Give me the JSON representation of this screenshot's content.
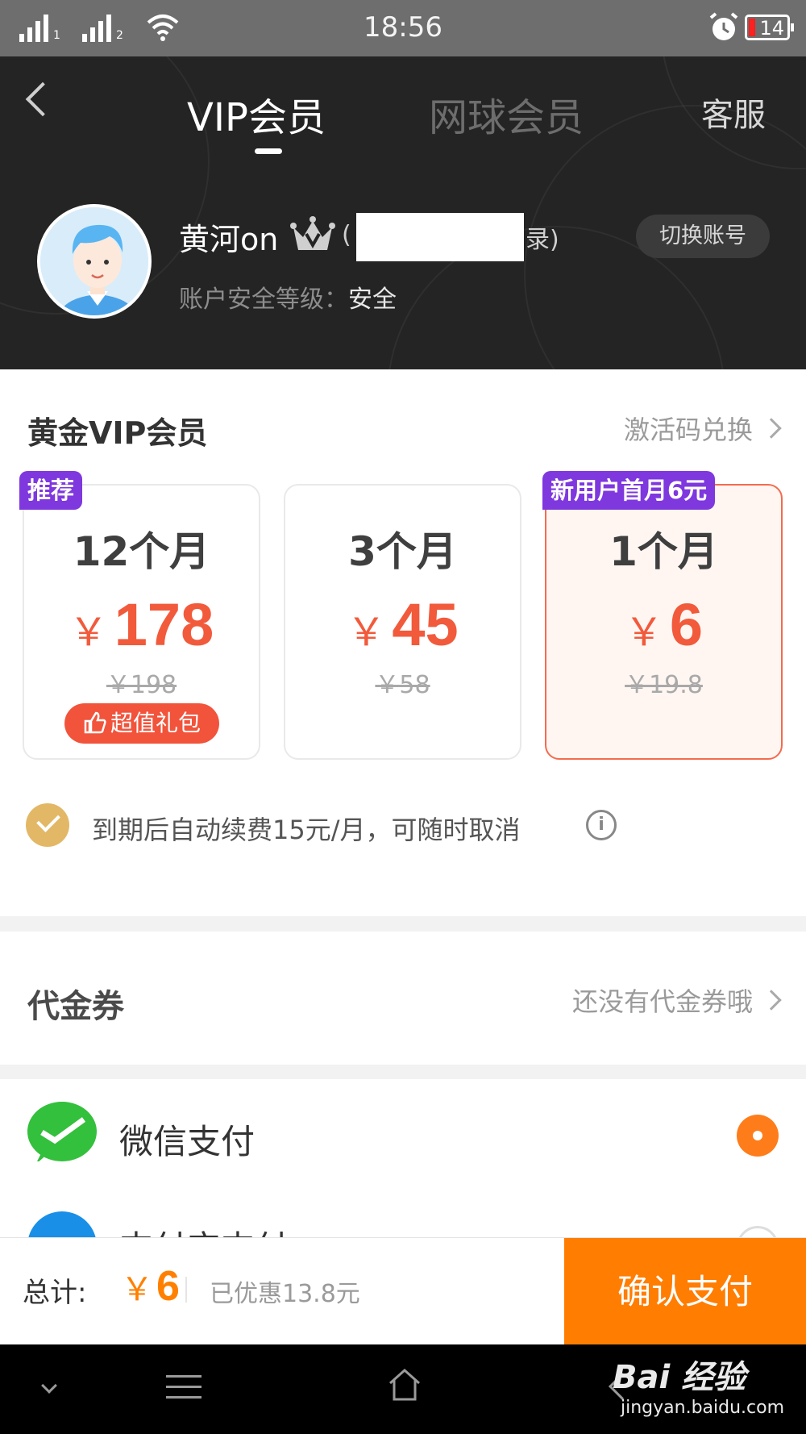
{
  "status_bar": {
    "time": "18:56",
    "sim1": "1",
    "sim2": "2",
    "battery": "14"
  },
  "header": {
    "tabs": [
      {
        "label": "VIP会员",
        "active": true
      },
      {
        "label": "网球会员",
        "active": false
      }
    ],
    "service_label": "客服",
    "user": {
      "name": "黄河on",
      "paren_open": "(",
      "login_suffix": "录)",
      "security_label": "账户安全等级：",
      "security_value": "安全"
    },
    "switch_account_label": "切换账号"
  },
  "plans_section": {
    "title": "黄金VIP会员",
    "redeem_label": "激活码兑换",
    "plans": [
      {
        "duration": "12个月",
        "currency": "￥",
        "price": "178",
        "original_price": "￥198",
        "tag": "推荐",
        "gift_label": "超值礼包",
        "selected": false
      },
      {
        "duration": "3个月",
        "currency": "￥",
        "price": "45",
        "original_price": "￥58",
        "selected": false
      },
      {
        "duration": "1个月",
        "currency": "￥",
        "price": "6",
        "original_price": "￥19.8",
        "tag": "新用户首月6元",
        "selected": true
      }
    ],
    "auto_renew_text": "到期后自动续费15元/月，可随时取消",
    "info_icon_text": "i"
  },
  "voucher": {
    "label": "代金券",
    "value": "还没有代金券哦"
  },
  "payment": {
    "methods": [
      {
        "label": "微信支付",
        "selected": true
      },
      {
        "label": "支付宝支付",
        "selected": false
      }
    ]
  },
  "bottom_bar": {
    "total_label": "总计:",
    "currency": "￥",
    "total_value": "6",
    "saved_text": "已优惠13.8元",
    "confirm_label": "确认支付"
  },
  "watermark": {
    "brand": "Bai 经验",
    "url": "jingyan.baidu.com"
  },
  "colors": {
    "accent_orange": "#ff7d00",
    "price_red": "#f25a3c",
    "tag_purple": "#7e38de",
    "header_bg": "#242424",
    "wechat_green": "#33c03c",
    "alipay_blue": "#1a8fe8"
  }
}
